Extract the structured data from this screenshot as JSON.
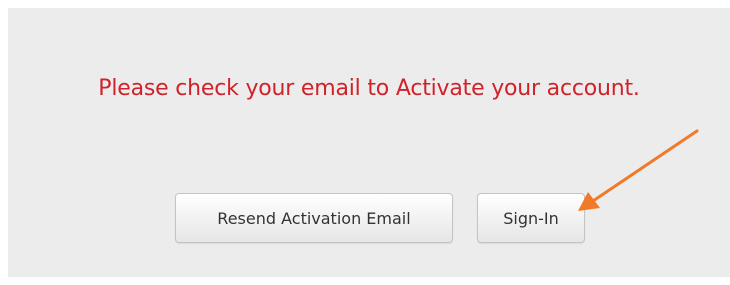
{
  "message": {
    "text": "Please check your email to Activate your account.",
    "color": "#d0222a"
  },
  "buttons": {
    "resend_label": "Resend Activation Email",
    "signin_label": "Sign-In"
  },
  "annotation": {
    "arrow_color": "#f07a2a",
    "points_to": "signin-button"
  },
  "colors": {
    "panel_background": "#ececec",
    "page_background": "#ffffff"
  }
}
